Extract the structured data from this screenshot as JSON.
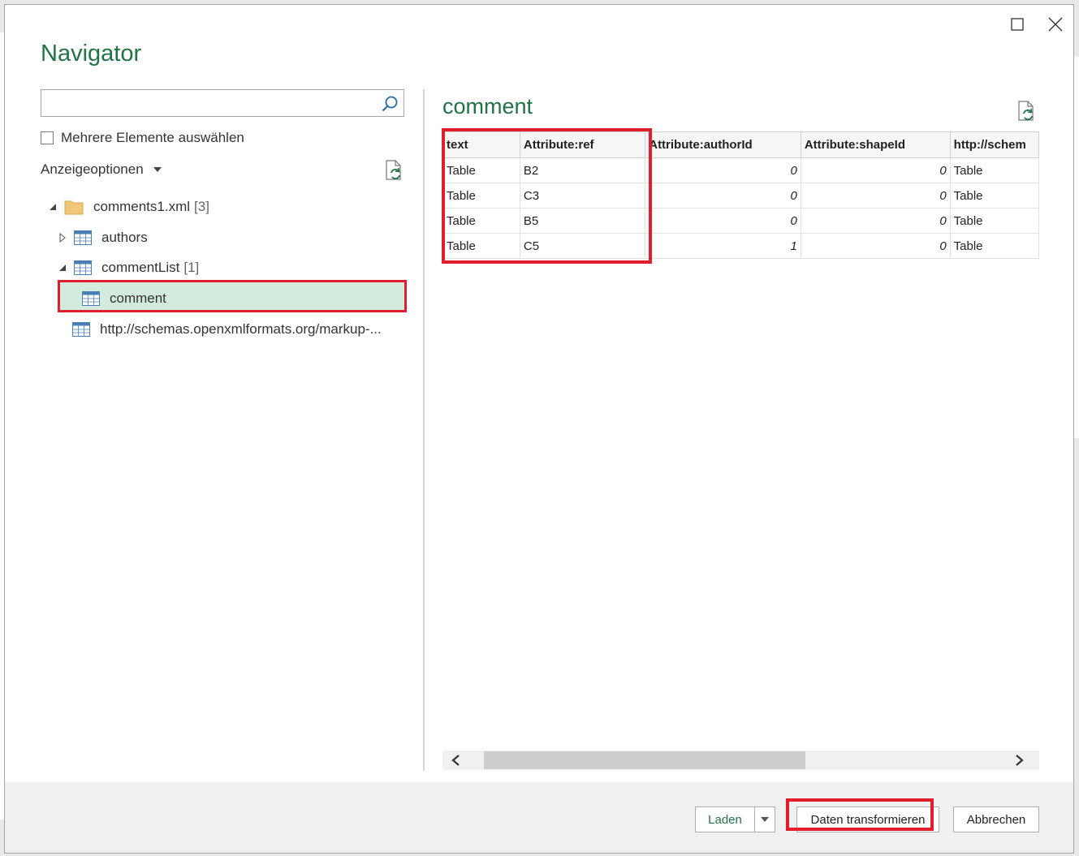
{
  "window": {
    "title": "Navigator"
  },
  "left_panel": {
    "search": {
      "value": "",
      "placeholder": ""
    },
    "multi_select_label": "Mehrere Elemente auswählen",
    "display_options_label": "Anzeigeoptionen",
    "tree": {
      "root": {
        "label": "comments1.xml",
        "count": "[3]"
      },
      "authors": {
        "label": "authors"
      },
      "commentList": {
        "label": "commentList",
        "count": "[1]"
      },
      "comment": {
        "label": "comment"
      },
      "schemas": {
        "label": "http://schemas.openxmlformats.org/markup-..."
      }
    }
  },
  "preview": {
    "title": "comment",
    "columns": [
      "text",
      "Attribute:ref",
      "Attribute:authorId",
      "Attribute:shapeId",
      "http://schem"
    ],
    "rows": [
      [
        "Table",
        "B2",
        "0",
        "0",
        "Table"
      ],
      [
        "Table",
        "C3",
        "0",
        "0",
        "Table"
      ],
      [
        "Table",
        "B5",
        "0",
        "0",
        "Table"
      ],
      [
        "Table",
        "C5",
        "1",
        "0",
        "Table"
      ]
    ]
  },
  "footer": {
    "load_label": "Laden",
    "transform_label": "Daten transformieren",
    "cancel_label": "Abbrechen"
  },
  "colors": {
    "accent": "#217346",
    "highlight": "#e01e2d",
    "selected_bg": "#d3ebdd"
  }
}
